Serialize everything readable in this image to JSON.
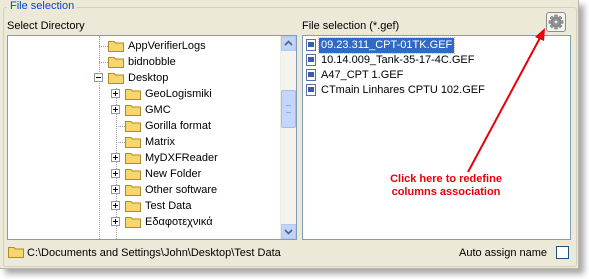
{
  "group_title": "File selection",
  "left_panel": {
    "label": "Select Directory",
    "tree": [
      {
        "label": "AppVerifierLogs",
        "level": 1,
        "expander": "none"
      },
      {
        "label": "bidnobble",
        "level": 1,
        "expander": "none"
      },
      {
        "label": "Desktop",
        "level": 1,
        "expander": "minus"
      },
      {
        "label": "GeoLogismiki",
        "level": 2,
        "expander": "plus"
      },
      {
        "label": "GMC",
        "level": 2,
        "expander": "plus"
      },
      {
        "label": "Gorilla format",
        "level": 2,
        "expander": "none"
      },
      {
        "label": "Matrix",
        "level": 2,
        "expander": "none"
      },
      {
        "label": "MyDXFReader",
        "level": 2,
        "expander": "plus"
      },
      {
        "label": "New Folder",
        "level": 2,
        "expander": "plus"
      },
      {
        "label": "Other software",
        "level": 2,
        "expander": "plus"
      },
      {
        "label": "Test Data",
        "level": 2,
        "expander": "plus"
      },
      {
        "label": "Εδαφοτεχνικά",
        "level": 2,
        "expander": "plus"
      }
    ]
  },
  "right_panel": {
    "label": "File selection (*.gef)",
    "files": [
      {
        "name": "09.23.311_CPT-01TK.GEF",
        "selected": true
      },
      {
        "name": "10.14.009_Tank-35-17-4C.GEF",
        "selected": false
      },
      {
        "name": "A47_CPT 1.GEF",
        "selected": false
      },
      {
        "name": "CTmain Linhares CPTU 102.GEF",
        "selected": false
      }
    ]
  },
  "annotation": {
    "text": "Click here to redefine columns association",
    "color": "#e8000b"
  },
  "footer": {
    "path": "C:\\Documents and Settings\\John\\Desktop\\Test Data",
    "auto_assign_label": "Auto assign name",
    "auto_assign_checked": false
  },
  "icons": {
    "settings": "gear-icon",
    "folder": "folder-icon",
    "file": "gef-file-icon"
  },
  "colors": {
    "title": "#0046d5",
    "selection": "#316ac5",
    "folder": "#f5d76e"
  }
}
